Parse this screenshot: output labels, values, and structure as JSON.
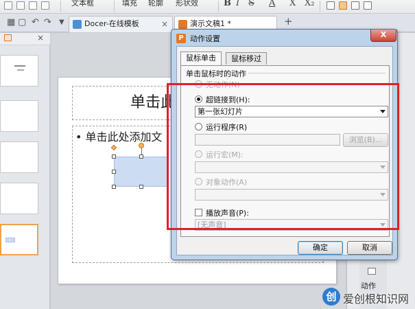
{
  "ribbon": {
    "text_box_label": "文本框",
    "fill_label": "填充",
    "outline_label": "轮廓",
    "shape_effect_label": "形状效",
    "bold": "B",
    "italic": "I",
    "strike": "S",
    "font_color": "A",
    "superscript": "X",
    "subscript": "X₂"
  },
  "tabs": [
    {
      "label": "Docer-在线模板",
      "close": "×"
    },
    {
      "label": "演示文稿1 *",
      "close": ""
    }
  ],
  "tabbar": {
    "add": "+"
  },
  "slide": {
    "title": "单击此",
    "body": "• 单击此处添加文"
  },
  "side": {
    "action_label": "动作"
  },
  "watermark": {
    "logo": "创",
    "text": "爱创根知识网"
  },
  "dialog": {
    "title": "动作设置",
    "close": "X",
    "tabs": [
      "鼠标单击",
      "鼠标移过"
    ],
    "group_label": "单击鼠标时的动作",
    "options": {
      "none": "无动作(N)",
      "hyperlink": "超链接到(H):",
      "run_program": "运行程序(R)",
      "run_macro": "运行宏(M):",
      "object_action": "对象动作(A)"
    },
    "hyperlink_value": "第一张幻灯片",
    "browse_button": "浏览(B)...",
    "play_sound": "播放声音(P):",
    "sound_value": "[无声音]",
    "ok": "确定",
    "cancel": "取消"
  }
}
